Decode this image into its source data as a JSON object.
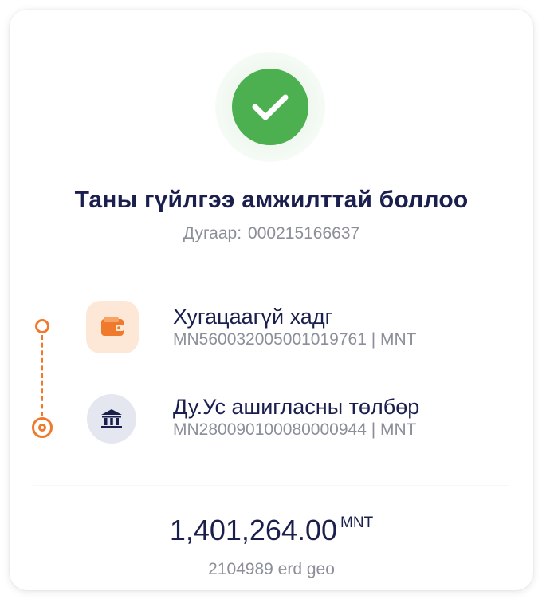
{
  "status": {
    "icon": "check-icon",
    "color": "#4caf50",
    "title": "Таны гүйлгээ амжилттай боллоо",
    "reference_label": "Дугаар:",
    "reference_number": "000215166637"
  },
  "transfer": {
    "from": {
      "icon": "wallet-icon",
      "name": "Хугацаагүй хадг",
      "account": "MN560032005001019761 | MNT"
    },
    "to": {
      "icon": "bank-icon",
      "name": "Ду.Ус ашигласны төлбөр",
      "account": "MN280090100080000944 | MNT"
    },
    "accent_color": "#f07a2b"
  },
  "amount": {
    "value": "1,401,264.00",
    "currency": "MNT",
    "description": "2104989 erd geo"
  }
}
